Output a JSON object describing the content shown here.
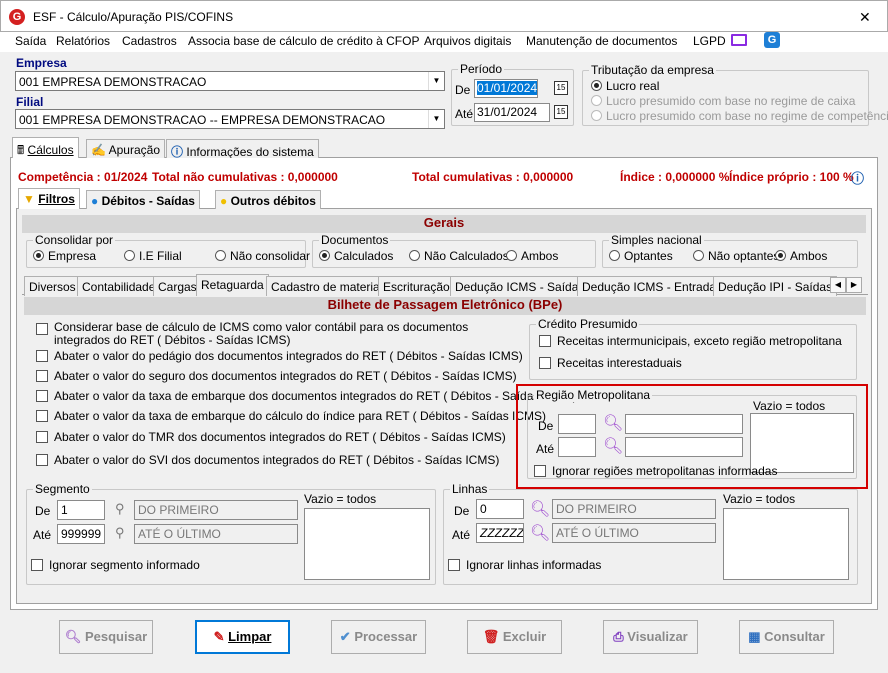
{
  "window": {
    "title": "ESF - Cálculo/Apuração PIS/COFINS",
    "close": "✕"
  },
  "menu": [
    "Saída",
    "Relatórios",
    "Cadastros",
    "Associa base de cálculo de crédito à CFOP",
    "Arquivos digitais",
    "Manutenção de documentos",
    "LGPD"
  ],
  "empresa": {
    "label": "Empresa",
    "value": "001 EMPRESA DEMONSTRACAO"
  },
  "filial": {
    "label": "Filial",
    "value": "001 EMPRESA DEMONSTRACAO -- EMPRESA DEMONSTRACAO"
  },
  "periodo": {
    "label": "Período",
    "de_label": "De",
    "de": "01/01/2024",
    "ate_label": "Até",
    "ate": "31/01/2024",
    "cal": "15"
  },
  "tributacao": {
    "label": "Tributação da empresa",
    "opts": [
      "Lucro real",
      "Lucro presumido com base no regime de caixa",
      "Lucro presumido com base no regime de competência"
    ]
  },
  "main_tabs": [
    "Cálculos",
    "Apuração",
    "Informações do sistema"
  ],
  "status": {
    "competencia": "Competência : 01/2024",
    "nao_cumul": "Total não cumulativas : 0,000000",
    "cumul": "Total cumulativas : 0,000000",
    "indice": "Índice : 0,000000 %",
    "indice_proprio": "Índice próprio : 100 %"
  },
  "sub_tabs": [
    "Filtros",
    "Débitos - Saídas",
    "Outros débitos"
  ],
  "gerais": "Gerais",
  "consolidar": {
    "label": "Consolidar por",
    "opts": [
      "Empresa",
      "I.E Filial",
      "Não consolidar"
    ]
  },
  "documentos": {
    "label": "Documentos",
    "opts": [
      "Calculados",
      "Não Calculados",
      "Ambos"
    ]
  },
  "simples": {
    "label": "Simples nacional",
    "opts": [
      "Optantes",
      "Não optantes",
      "Ambos"
    ]
  },
  "tabs3": [
    "Diversos",
    "Contabilidade",
    "Cargas",
    "Retaguarda",
    "Cadastro de materiais",
    "Escrituração",
    "Dedução ICMS - Saídas",
    "Dedução ICMS - Entradas",
    "Dedução IPI - Saídas"
  ],
  "bpe": "Bilhete de Passagem Eletrônico (BPe)",
  "checks": [
    "Considerar base de cálculo de ICMS como valor contábil para os documentos integrados do RET ( Débitos - Saídas ICMS)",
    "Abater o valor do pedágio dos documentos integrados do RET ( Débitos - Saídas ICMS)",
    "Abater o valor do seguro dos documentos integrados do RET ( Débitos - Saídas ICMS)",
    "Abater o valor da taxa de embarque dos documentos integrados do RET ( Débitos - Saídas ICMS)",
    "Abater o valor da taxa de embarque do cálculo do índice para RET ( Débitos - Saídas ICMS)",
    "Abater o valor do TMR dos documentos integrados do RET ( Débitos - Saídas ICMS)",
    "Abater o valor do SVI dos documentos integrados do RET ( Débitos - Saídas ICMS)"
  ],
  "credito": {
    "label": "Crédito Presumido",
    "opts": [
      "Receitas intermunicipais, exceto região metropolitana",
      "Receitas interestaduais"
    ]
  },
  "regiao": {
    "label": "Região Metropolitana",
    "de": "De",
    "ate": "Até",
    "vazio": "Vazio = todos",
    "ignorar": "Ignorar regiões metropolitanas informadas"
  },
  "segmento": {
    "label": "Segmento",
    "de": "De",
    "de_val": "1",
    "de_desc": "DO PRIMEIRO",
    "ate": "Até",
    "ate_val": "999999",
    "ate_desc": "ATÉ O ÚLTIMO",
    "vazio": "Vazio = todos",
    "ignorar": "Ignorar segmento informado"
  },
  "linhas": {
    "label": "Linhas",
    "de": "De",
    "de_val": "0",
    "de_desc": "DO PRIMEIRO",
    "ate": "Até",
    "ate_val": "ZZZZZZ",
    "ate_desc": "ATÉ O ÚLTIMO",
    "vazio": "Vazio = todos",
    "ignorar": "Ignorar linhas informadas"
  },
  "buttons": [
    "Pesquisar",
    "Limpar",
    "Processar",
    "Excluir",
    "Visualizar",
    "Consultar"
  ],
  "colors": {
    "highlight": "#d40000",
    "accent": "#0078d7",
    "label_red": "#c00000"
  }
}
